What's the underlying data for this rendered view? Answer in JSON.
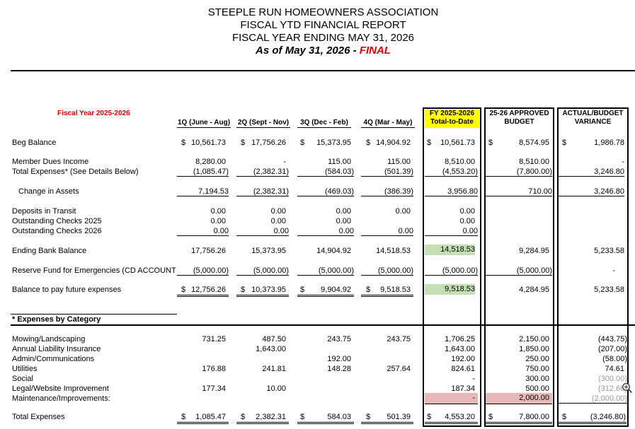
{
  "header": {
    "line1": "STEEPLE RUN HOMEOWNERS ASSOCIATION",
    "line2": "FISCAL YTD FINANCIAL REPORT",
    "line3": "FISCAL YEAR ENDING MAY 31, 2026",
    "line4_prefix": "As of May 31, 2026 - ",
    "line4_status": "FINAL"
  },
  "fiscal_year_label": "Fiscal Year 2025-2026",
  "columns": {
    "q1": "1Q (June - Aug)",
    "q2": "2Q (Sept - Nov)",
    "q3": "3Q (Dec - Feb)",
    "q4": "4Q (Mar - May)",
    "fy_line1": "FY 2025-2026",
    "fy_line2": "Total-to-Date",
    "budget_line1": "25-26 APPROVED",
    "budget_line2": "BUDGET",
    "var_line1": "ACTUAL/BUDGET",
    "var_line2": "VARIANCE"
  },
  "currency": "$",
  "rows": {
    "beg_balance": {
      "label": "Beg Balance",
      "q1": "10,561.73",
      "q2": "17,756.26",
      "q3": "15,373.95",
      "q4": "14,904.92",
      "fy": "10,561.73",
      "budget": "8,574.95",
      "var": "1,986.78"
    },
    "dues": {
      "label": "Member Dues Income",
      "q1": "8,280.00",
      "q2": "-",
      "q3": "115.00",
      "q4": "115.00",
      "fy": "8,510.00",
      "budget": "8,510.00",
      "var": "-"
    },
    "expenses": {
      "label": "Total Expenses* (See Details Below)",
      "q1": "(1,085.47)",
      "q2": "(2,382.31)",
      "q3": "(584.03)",
      "q4": "(501.39)",
      "fy": "(4,553.20)",
      "budget": "(7,800.00)",
      "var": "3,246.80"
    },
    "change": {
      "label": "Change in Assets",
      "q1": "7,194.53",
      "q2": "(2,382.31)",
      "q3": "(469.03)",
      "q4": "(386.39)",
      "fy": "3,956.80",
      "budget": "710.00",
      "var": "3,246.80"
    },
    "deposits": {
      "label": "Deposits in Transit",
      "q1": "0.00",
      "q2": "0.00",
      "q3": "0.00",
      "q4": "0.00",
      "fy": "0.00"
    },
    "checks25": {
      "label": "Outstanding Checks 2025",
      "q1": "0.00",
      "q2": "0.00",
      "q3": "0.00",
      "fy": "0.00"
    },
    "checks26": {
      "label": "Outstanding Checks 2026",
      "q1": "0.00",
      "q2": "0.00",
      "q3": "0.00",
      "q4": "0.00",
      "fy": "0.00"
    },
    "ending": {
      "label": "Ending Bank Balance",
      "q1": "17,756.26",
      "q2": "15,373.95",
      "q3": "14,904.92",
      "q4": "14,518.53",
      "fy": "14,518.53",
      "budget": "9,284.95",
      "var": "5,233.58"
    },
    "reserve": {
      "label": "Reserve Fund for Emergencies (CD ACCOUNT",
      "q1": "(5,000.00)",
      "q2": "(5,000.00)",
      "q3": "(5,000.00)",
      "q4": "(5,000.00)",
      "fy": "(5,000.00)",
      "budget": "(5,000.00)",
      "var": "-"
    },
    "future": {
      "label": "Balance to pay future expenses",
      "q1": "12,756.26",
      "q2": "10,373.95",
      "q3": "9,904.92",
      "q4": "9,518.53",
      "fy": "9,518.53",
      "budget": "4,284.95",
      "var": "5,233.58"
    }
  },
  "expenses_section": {
    "title": "* Expenses by Category",
    "items": [
      {
        "label": "Mowing/Landscaping",
        "q1": "731.25",
        "q2": "487.50",
        "q3": "243.75",
        "q4": "243.75",
        "fy": "1,706.25",
        "budget": "2,150.00",
        "var": "(443.75)"
      },
      {
        "label": "Annual Liability Insurance",
        "q2": "1,643.00",
        "fy": "1,643.00",
        "budget": "1,850.00",
        "var": "(207.00)"
      },
      {
        "label": "Admin/Communications",
        "q3": "192.00",
        "fy": "192.00",
        "budget": "250.00",
        "var": "(58.00)"
      },
      {
        "label": "Utilities",
        "q1": "176.88",
        "q2": "241.81",
        "q3": "148.28",
        "q4": "257.64",
        "fy": "824.61",
        "budget": "750.00",
        "var": "74.61"
      },
      {
        "label": "Social",
        "fy": "-",
        "budget": "300.00",
        "var": "(300.00)"
      },
      {
        "label": "Legal/Website Improvement",
        "q1": "177.34",
        "q2": "10.00",
        "fy": "187.34",
        "budget": "500.00",
        "var": "(312.66)"
      },
      {
        "label": "Maintenance/Improvements:",
        "fy": "-",
        "budget": "2,000.00",
        "var": "(2,000.00)"
      }
    ],
    "total": {
      "label": "Total Expenses",
      "q1": "1,085.47",
      "q2": "2,382.31",
      "q3": "584.03",
      "q4": "501.39",
      "fy": "4,553.20",
      "budget": "7,800.00",
      "var": "(3,246.80)"
    }
  },
  "colors": {
    "fy_header": "#ffff00",
    "balance_highlight": "#c5dfb4",
    "maintenance_highlight": "#e6b8b7",
    "final_status": "#e00000"
  },
  "icons": {
    "zoom": "zoom-in-icon"
  }
}
